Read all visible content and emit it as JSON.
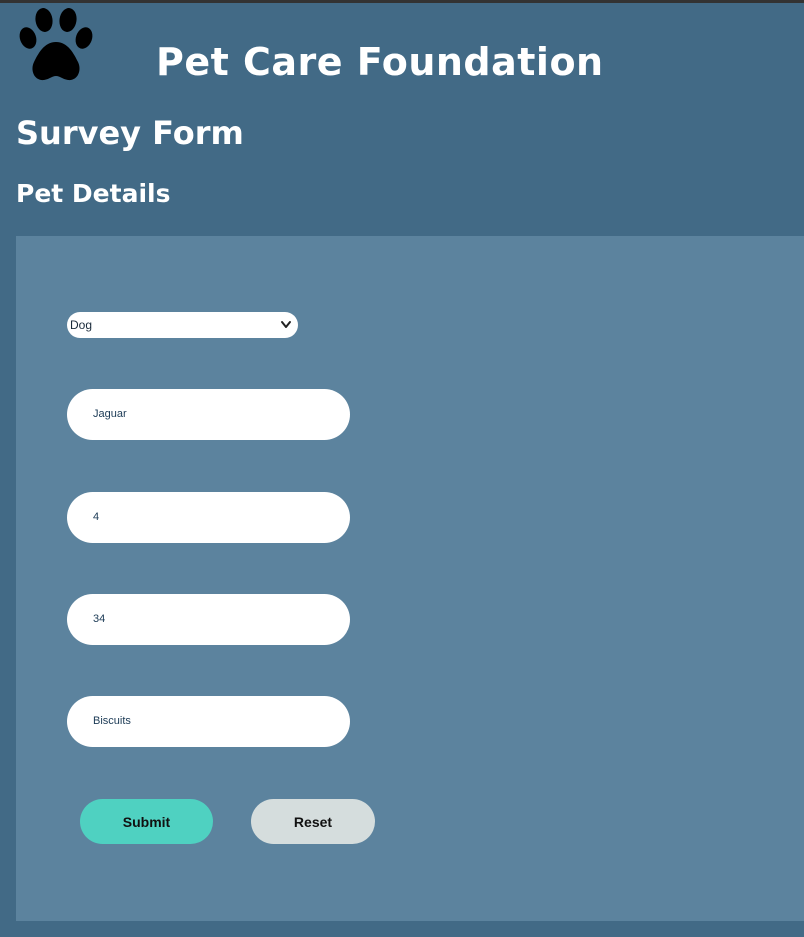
{
  "header": {
    "site_title": "Pet Care Foundation",
    "form_title": "Survey Form",
    "section_title": "Pet Details"
  },
  "form": {
    "pet_type_selected": "Dog",
    "fields": [
      {
        "value": "Jaguar"
      },
      {
        "value": "4"
      },
      {
        "value": "34"
      },
      {
        "value": "Biscuits"
      }
    ],
    "submit_label": "Submit",
    "reset_label": "Reset"
  },
  "icons": {
    "logo": "paw-print-icon",
    "select_arrow": "chevron-down-icon"
  },
  "colors": {
    "background": "#426a86",
    "panel": "#5c839e",
    "submit": "#4fd1c1",
    "reset": "#d5dddd",
    "text_light": "#ffffff"
  }
}
